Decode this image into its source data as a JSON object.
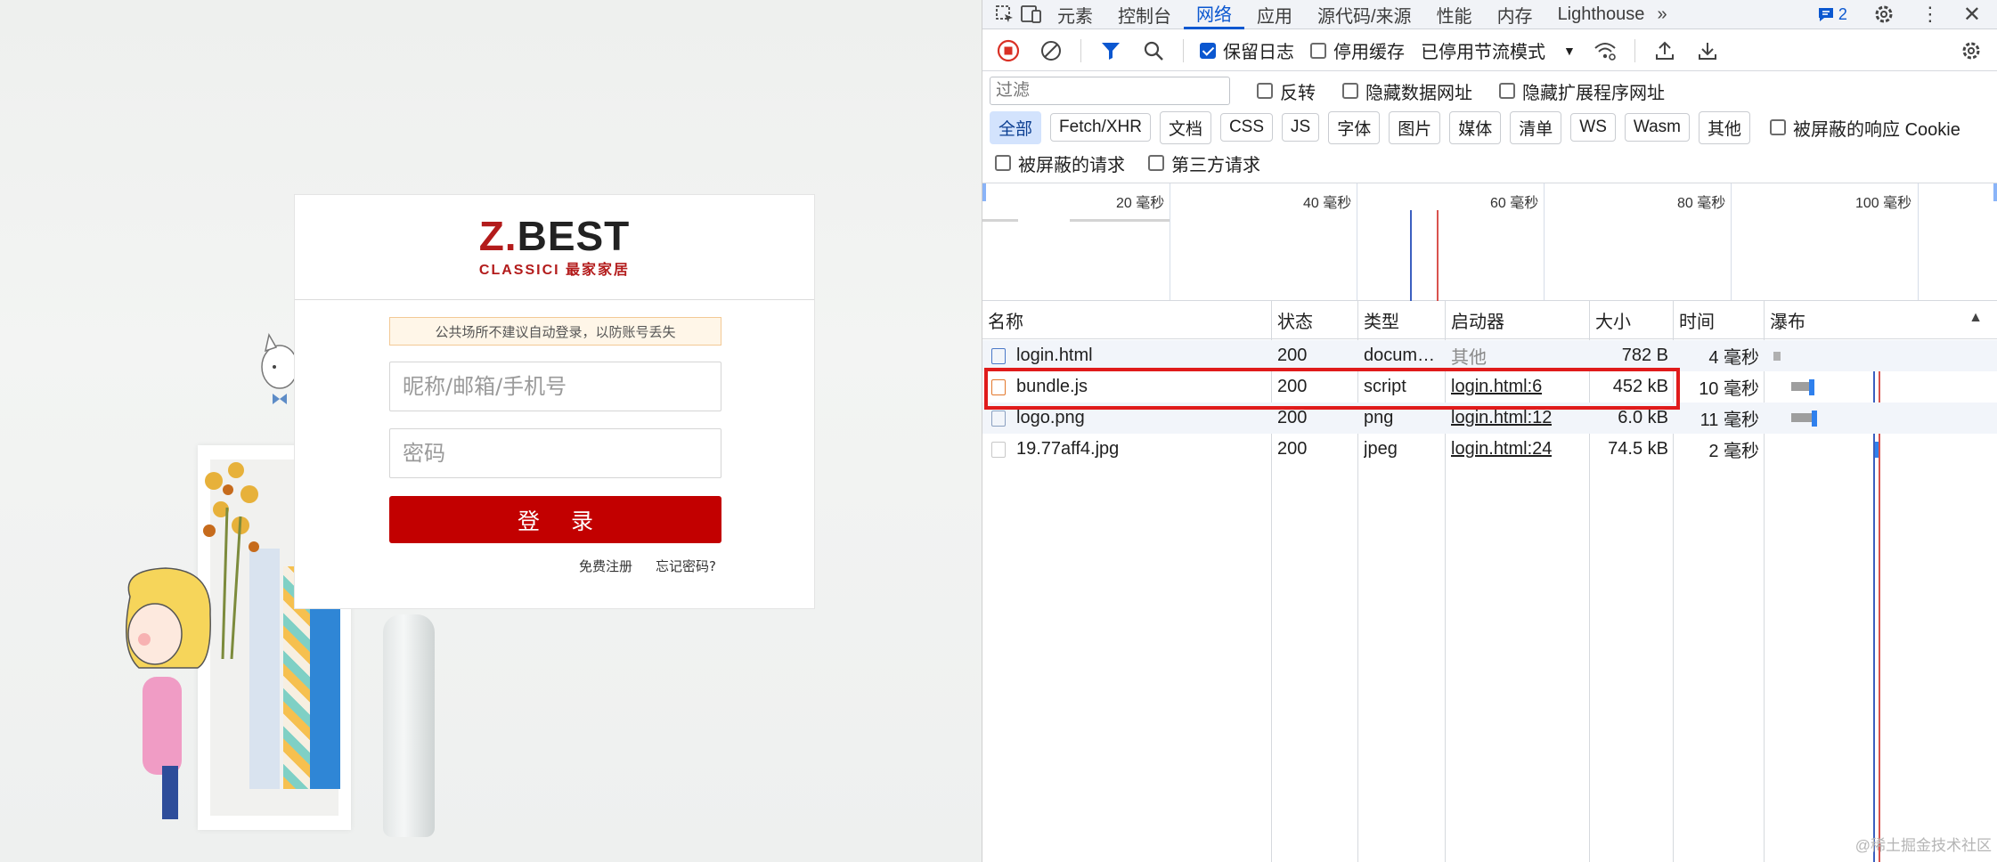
{
  "login": {
    "logo_main_z": "Z.",
    "logo_main_rest": "BEST",
    "logo_sub": "CLASSICI 最家家居",
    "notice": "公共场所不建议自动登录，以防账号丢失",
    "username_placeholder": "昵称/邮箱/手机号",
    "password_placeholder": "密码",
    "login_button": "登 录",
    "register_link": "免费注册",
    "forgot_link": "忘记密码?"
  },
  "devtools": {
    "tabs": [
      "元素",
      "控制台",
      "网络",
      "应用",
      "源代码/来源",
      "性能",
      "内存",
      "Lighthouse"
    ],
    "active_tab": "网络",
    "issues_count": "2",
    "toolbar": {
      "preserve_log": "保留日志",
      "disable_cache": "停用缓存",
      "throttling": "已停用节流模式"
    },
    "filter": {
      "placeholder": "过滤",
      "invert": "反转",
      "hide_data_urls": "隐藏数据网址",
      "hide_ext_urls": "隐藏扩展程序网址"
    },
    "type_filters": [
      "全部",
      "Fetch/XHR",
      "文档",
      "CSS",
      "JS",
      "字体",
      "图片",
      "媒体",
      "清单",
      "WS",
      "Wasm",
      "其他"
    ],
    "blocked_cookies": "被屏蔽的响应 Cookie",
    "blocked_requests": "被屏蔽的请求",
    "third_party": "第三方请求",
    "overview_labels": [
      "20 毫秒",
      "40 毫秒",
      "60 毫秒",
      "80 毫秒",
      "100 毫秒"
    ],
    "columns": [
      "名称",
      "状态",
      "类型",
      "启动器",
      "大小",
      "时间",
      "瀑布"
    ],
    "requests": [
      {
        "name": "login.html",
        "status": "200",
        "type": "docum…",
        "initiator": "其他",
        "size": "782 B",
        "time": "4 毫秒",
        "icon": "document-icon"
      },
      {
        "name": "bundle.js",
        "status": "200",
        "type": "script",
        "initiator": "login.html:6",
        "size": "452 kB",
        "time": "10 毫秒",
        "icon": "script-icon"
      },
      {
        "name": "logo.png",
        "status": "200",
        "type": "png",
        "initiator": "login.html:12",
        "size": "6.0 kB",
        "time": "11 毫秒",
        "icon": "image-icon"
      },
      {
        "name": "19.77aff4.jpg",
        "status": "200",
        "type": "jpeg",
        "initiator": "login.html:24",
        "size": "74.5 kB",
        "time": "2 毫秒",
        "icon": "image-icon"
      }
    ],
    "watermark": "@稀土掘金技术社区",
    "colors": {
      "accent": "#0b57d0",
      "highlight": "#e01b1b",
      "login_red": "#c20000"
    }
  }
}
